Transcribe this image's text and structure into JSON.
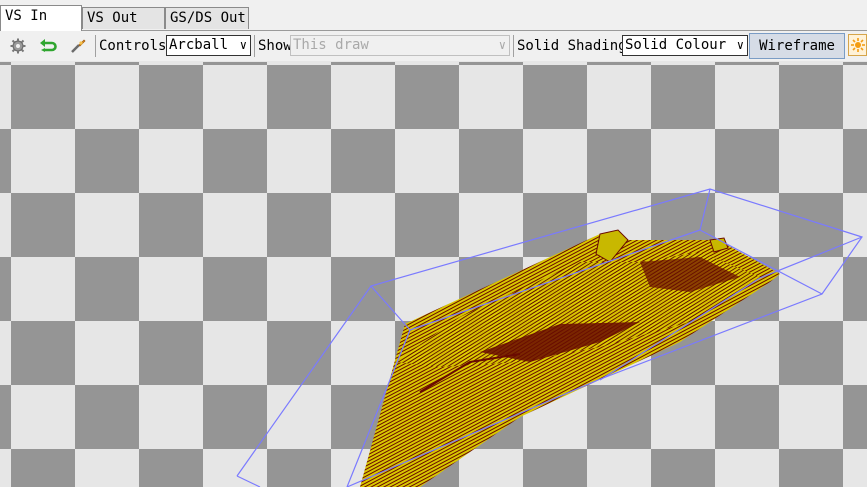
{
  "tabs": [
    {
      "label": "VS In",
      "active": true
    },
    {
      "label": "VS Out",
      "active": false
    },
    {
      "label": "GS/DS Out",
      "active": false
    }
  ],
  "toolbar": {
    "controls_label": "Controls",
    "controls_value": "Arcball",
    "show_label": "Show",
    "show_value": "This draw",
    "shading_label": "Solid Shading",
    "shading_value": "Solid Colour",
    "wireframe_label": "Wireframe"
  },
  "icons": [
    "gear-icon",
    "reset-icon",
    "pick-icon",
    "fill-icon"
  ],
  "colors": {
    "checker_dark": "#959595",
    "checker_light": "#e6e6e6",
    "mesh_fill": "#d8c800",
    "mesh_dark": "#6a0a00",
    "bbox": "#7a7aff"
  }
}
